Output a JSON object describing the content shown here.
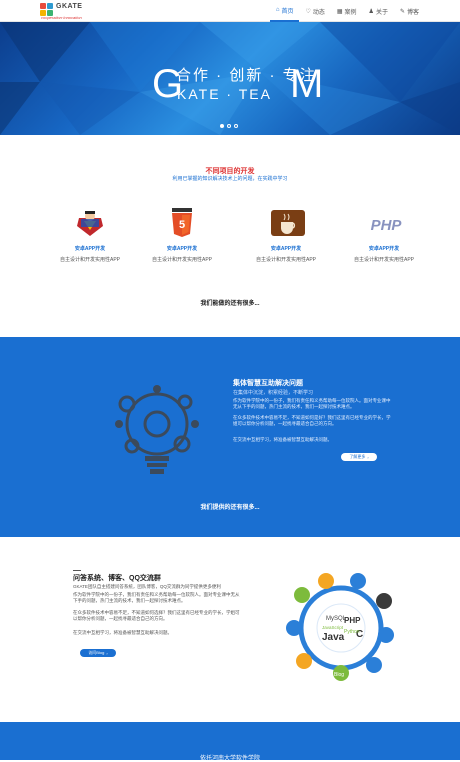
{
  "header": {
    "logo_text": "GKATE",
    "logo_sub": "cooperation·Innovation",
    "nav": [
      {
        "label": "首页",
        "icon": "home-icon",
        "glyph": "⌂"
      },
      {
        "label": "动态",
        "icon": "heart-icon",
        "glyph": "♡"
      },
      {
        "label": "案例",
        "icon": "grid-icon",
        "glyph": "▦"
      },
      {
        "label": "关于",
        "icon": "user-icon",
        "glyph": "♟"
      },
      {
        "label": "博客",
        "icon": "leaf-icon",
        "glyph": "✎"
      }
    ],
    "active_index": 0
  },
  "hero": {
    "top_text": "合作 · 创新 · 专注",
    "bottom_text": "KATE · TEA",
    "left_letter": "G",
    "right_letter": "M",
    "slide_count": 3,
    "active_slide": 0
  },
  "projects": {
    "title": "不同项目的开发",
    "subtitle": "利用已掌握的知识解决技术上的问题，在实践中学习",
    "cards": [
      {
        "icon": "superman-icon",
        "title": "安卓APP开发",
        "desc": "自主设计和开发实用性APP"
      },
      {
        "icon": "html5-icon",
        "title": "安卓APP开发",
        "desc": "自主设计和开发实用性APP"
      },
      {
        "icon": "java-coffee-icon",
        "title": "安卓APP开发",
        "desc": "自主设计和开发实用性APP"
      },
      {
        "icon": "php-icon",
        "title": "安卓APP开发",
        "desc": "自主设计和开发实用性APP"
      }
    ],
    "more": "我们能做的还有很多..."
  },
  "band": {
    "title": "集体智慧互助解决问题",
    "subtitle": "在集体中沉淀，积累经验，不断学习",
    "paragraphs": [
      "作为软件学院中的一份子，我们有责任和义务帮助每一位软院人。面对专业课中无从下手的问题，热门主流的技术，我们一起探讨技术难点。",
      "在众多软件技术中容易不足，不知道如何是好？我们这里有已经专业的学长，学姐可以帮你分析问题，一起找寻最适合自己的方向。",
      "在交流中互相学习，将准备被智慧互助解决问题。"
    ],
    "button": "了解更多",
    "more": "我们提供的还有很多..."
  },
  "qq": {
    "title": "问答系统、博客、QQ交流群",
    "paragraphs": [
      "GKATE团队自主搭建问答系统，团队博客，QQ交流群为同学提供更多便利",
      "作为软件学院中的一份子，我们有责任和义务帮助每一位软院人。面对专业课中无从下手的问题，热门主流的技术，我们一起探讨技术难点。",
      "在众多软件技术中容易不足，不知道如何选择？我们这里有已经专业的学长，学姐可以帮你分析问题，一起找寻最适合自己的方向。",
      "在交流中互相学习，将准备被智慧互助解决问题。"
    ],
    "button": "访问Blog",
    "hub_labels": [
      "MySQL",
      "PHP",
      "JavaScript",
      "Java",
      "C",
      "Python",
      "Blog"
    ]
  },
  "footer": {
    "text": "依托河南大学软件学院"
  },
  "colors": {
    "brand_blue": "#1a6fd1",
    "accent_red": "#dd3333"
  }
}
